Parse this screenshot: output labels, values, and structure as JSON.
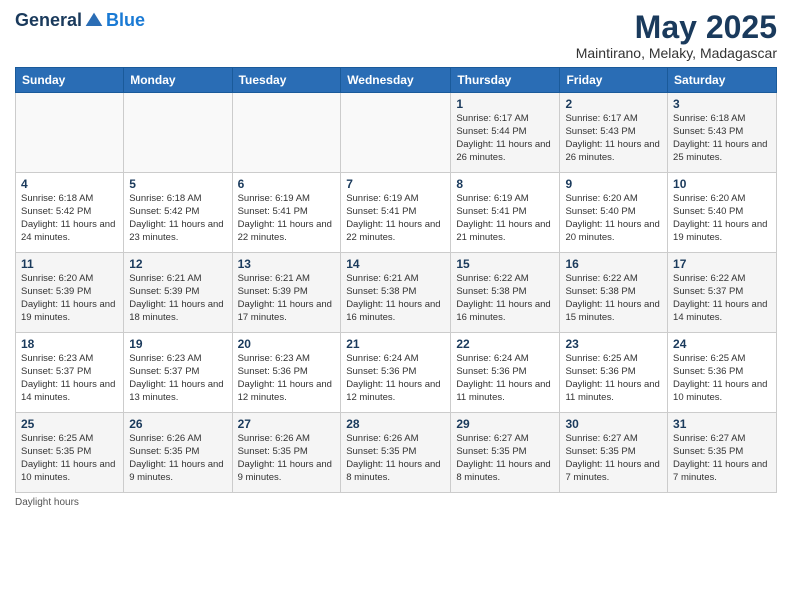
{
  "header": {
    "logo_general": "General",
    "logo_blue": "Blue",
    "title": "May 2025",
    "subtitle": "Maintirano, Melaky, Madagascar"
  },
  "calendar": {
    "days_of_week": [
      "Sunday",
      "Monday",
      "Tuesday",
      "Wednesday",
      "Thursday",
      "Friday",
      "Saturday"
    ],
    "weeks": [
      [
        {
          "day": "",
          "info": ""
        },
        {
          "day": "",
          "info": ""
        },
        {
          "day": "",
          "info": ""
        },
        {
          "day": "",
          "info": ""
        },
        {
          "day": "1",
          "info": "Sunrise: 6:17 AM\nSunset: 5:44 PM\nDaylight: 11 hours and 26 minutes."
        },
        {
          "day": "2",
          "info": "Sunrise: 6:17 AM\nSunset: 5:43 PM\nDaylight: 11 hours and 26 minutes."
        },
        {
          "day": "3",
          "info": "Sunrise: 6:18 AM\nSunset: 5:43 PM\nDaylight: 11 hours and 25 minutes."
        }
      ],
      [
        {
          "day": "4",
          "info": "Sunrise: 6:18 AM\nSunset: 5:42 PM\nDaylight: 11 hours and 24 minutes."
        },
        {
          "day": "5",
          "info": "Sunrise: 6:18 AM\nSunset: 5:42 PM\nDaylight: 11 hours and 23 minutes."
        },
        {
          "day": "6",
          "info": "Sunrise: 6:19 AM\nSunset: 5:41 PM\nDaylight: 11 hours and 22 minutes."
        },
        {
          "day": "7",
          "info": "Sunrise: 6:19 AM\nSunset: 5:41 PM\nDaylight: 11 hours and 22 minutes."
        },
        {
          "day": "8",
          "info": "Sunrise: 6:19 AM\nSunset: 5:41 PM\nDaylight: 11 hours and 21 minutes."
        },
        {
          "day": "9",
          "info": "Sunrise: 6:20 AM\nSunset: 5:40 PM\nDaylight: 11 hours and 20 minutes."
        },
        {
          "day": "10",
          "info": "Sunrise: 6:20 AM\nSunset: 5:40 PM\nDaylight: 11 hours and 19 minutes."
        }
      ],
      [
        {
          "day": "11",
          "info": "Sunrise: 6:20 AM\nSunset: 5:39 PM\nDaylight: 11 hours and 19 minutes."
        },
        {
          "day": "12",
          "info": "Sunrise: 6:21 AM\nSunset: 5:39 PM\nDaylight: 11 hours and 18 minutes."
        },
        {
          "day": "13",
          "info": "Sunrise: 6:21 AM\nSunset: 5:39 PM\nDaylight: 11 hours and 17 minutes."
        },
        {
          "day": "14",
          "info": "Sunrise: 6:21 AM\nSunset: 5:38 PM\nDaylight: 11 hours and 16 minutes."
        },
        {
          "day": "15",
          "info": "Sunrise: 6:22 AM\nSunset: 5:38 PM\nDaylight: 11 hours and 16 minutes."
        },
        {
          "day": "16",
          "info": "Sunrise: 6:22 AM\nSunset: 5:38 PM\nDaylight: 11 hours and 15 minutes."
        },
        {
          "day": "17",
          "info": "Sunrise: 6:22 AM\nSunset: 5:37 PM\nDaylight: 11 hours and 14 minutes."
        }
      ],
      [
        {
          "day": "18",
          "info": "Sunrise: 6:23 AM\nSunset: 5:37 PM\nDaylight: 11 hours and 14 minutes."
        },
        {
          "day": "19",
          "info": "Sunrise: 6:23 AM\nSunset: 5:37 PM\nDaylight: 11 hours and 13 minutes."
        },
        {
          "day": "20",
          "info": "Sunrise: 6:23 AM\nSunset: 5:36 PM\nDaylight: 11 hours and 12 minutes."
        },
        {
          "day": "21",
          "info": "Sunrise: 6:24 AM\nSunset: 5:36 PM\nDaylight: 11 hours and 12 minutes."
        },
        {
          "day": "22",
          "info": "Sunrise: 6:24 AM\nSunset: 5:36 PM\nDaylight: 11 hours and 11 minutes."
        },
        {
          "day": "23",
          "info": "Sunrise: 6:25 AM\nSunset: 5:36 PM\nDaylight: 11 hours and 11 minutes."
        },
        {
          "day": "24",
          "info": "Sunrise: 6:25 AM\nSunset: 5:36 PM\nDaylight: 11 hours and 10 minutes."
        }
      ],
      [
        {
          "day": "25",
          "info": "Sunrise: 6:25 AM\nSunset: 5:35 PM\nDaylight: 11 hours and 10 minutes."
        },
        {
          "day": "26",
          "info": "Sunrise: 6:26 AM\nSunset: 5:35 PM\nDaylight: 11 hours and 9 minutes."
        },
        {
          "day": "27",
          "info": "Sunrise: 6:26 AM\nSunset: 5:35 PM\nDaylight: 11 hours and 9 minutes."
        },
        {
          "day": "28",
          "info": "Sunrise: 6:26 AM\nSunset: 5:35 PM\nDaylight: 11 hours and 8 minutes."
        },
        {
          "day": "29",
          "info": "Sunrise: 6:27 AM\nSunset: 5:35 PM\nDaylight: 11 hours and 8 minutes."
        },
        {
          "day": "30",
          "info": "Sunrise: 6:27 AM\nSunset: 5:35 PM\nDaylight: 11 hours and 7 minutes."
        },
        {
          "day": "31",
          "info": "Sunrise: 6:27 AM\nSunset: 5:35 PM\nDaylight: 11 hours and 7 minutes."
        }
      ]
    ]
  },
  "footer": {
    "note": "Daylight hours"
  }
}
